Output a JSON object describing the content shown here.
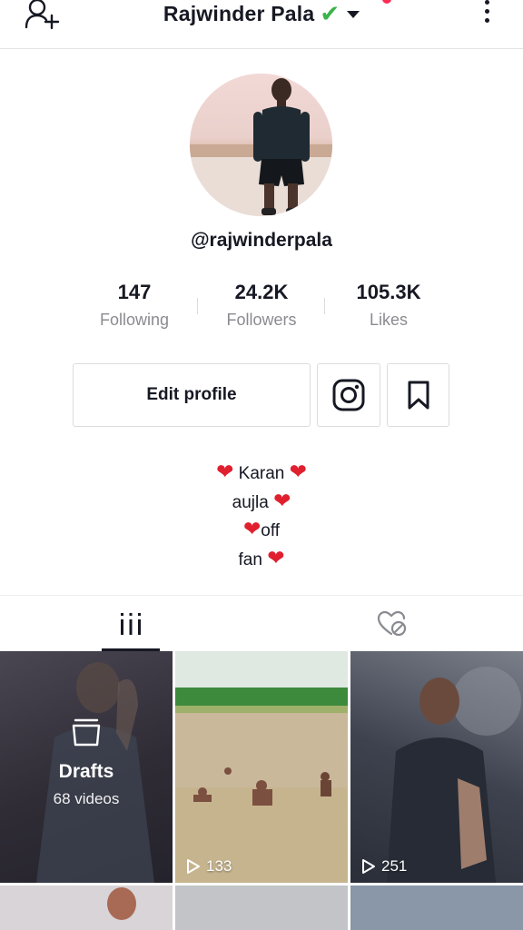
{
  "header": {
    "title": "Rajwinder Pala",
    "verified_glyph": "✔",
    "add_friend_icon": "add-user-icon",
    "more_icon": "more-vertical-icon"
  },
  "profile": {
    "username": "@rajwinderpala",
    "stats": [
      {
        "value": "147",
        "label": "Following"
      },
      {
        "value": "24.2K",
        "label": "Followers"
      },
      {
        "value": "105.3K",
        "label": "Likes"
      }
    ],
    "edit_label": "Edit profile",
    "bio": {
      "line1": "Karan",
      "line2": "aujla",
      "line3": "off",
      "line4": "fan"
    },
    "heart_glyph": "❤"
  },
  "tabs": [
    {
      "name": "videos",
      "icon": "grid-icon",
      "active": true
    },
    {
      "name": "liked",
      "icon": "liked-private-icon",
      "active": false
    }
  ],
  "grid": {
    "drafts": {
      "title": "Drafts",
      "count": "68 videos"
    },
    "videos": [
      {
        "views": "133"
      },
      {
        "views": "251"
      }
    ]
  },
  "colors": {
    "accent": "#fe2c55",
    "verified": "#3bb34a",
    "heart": "#e0202e",
    "secondary_text": "#8a8b91"
  }
}
